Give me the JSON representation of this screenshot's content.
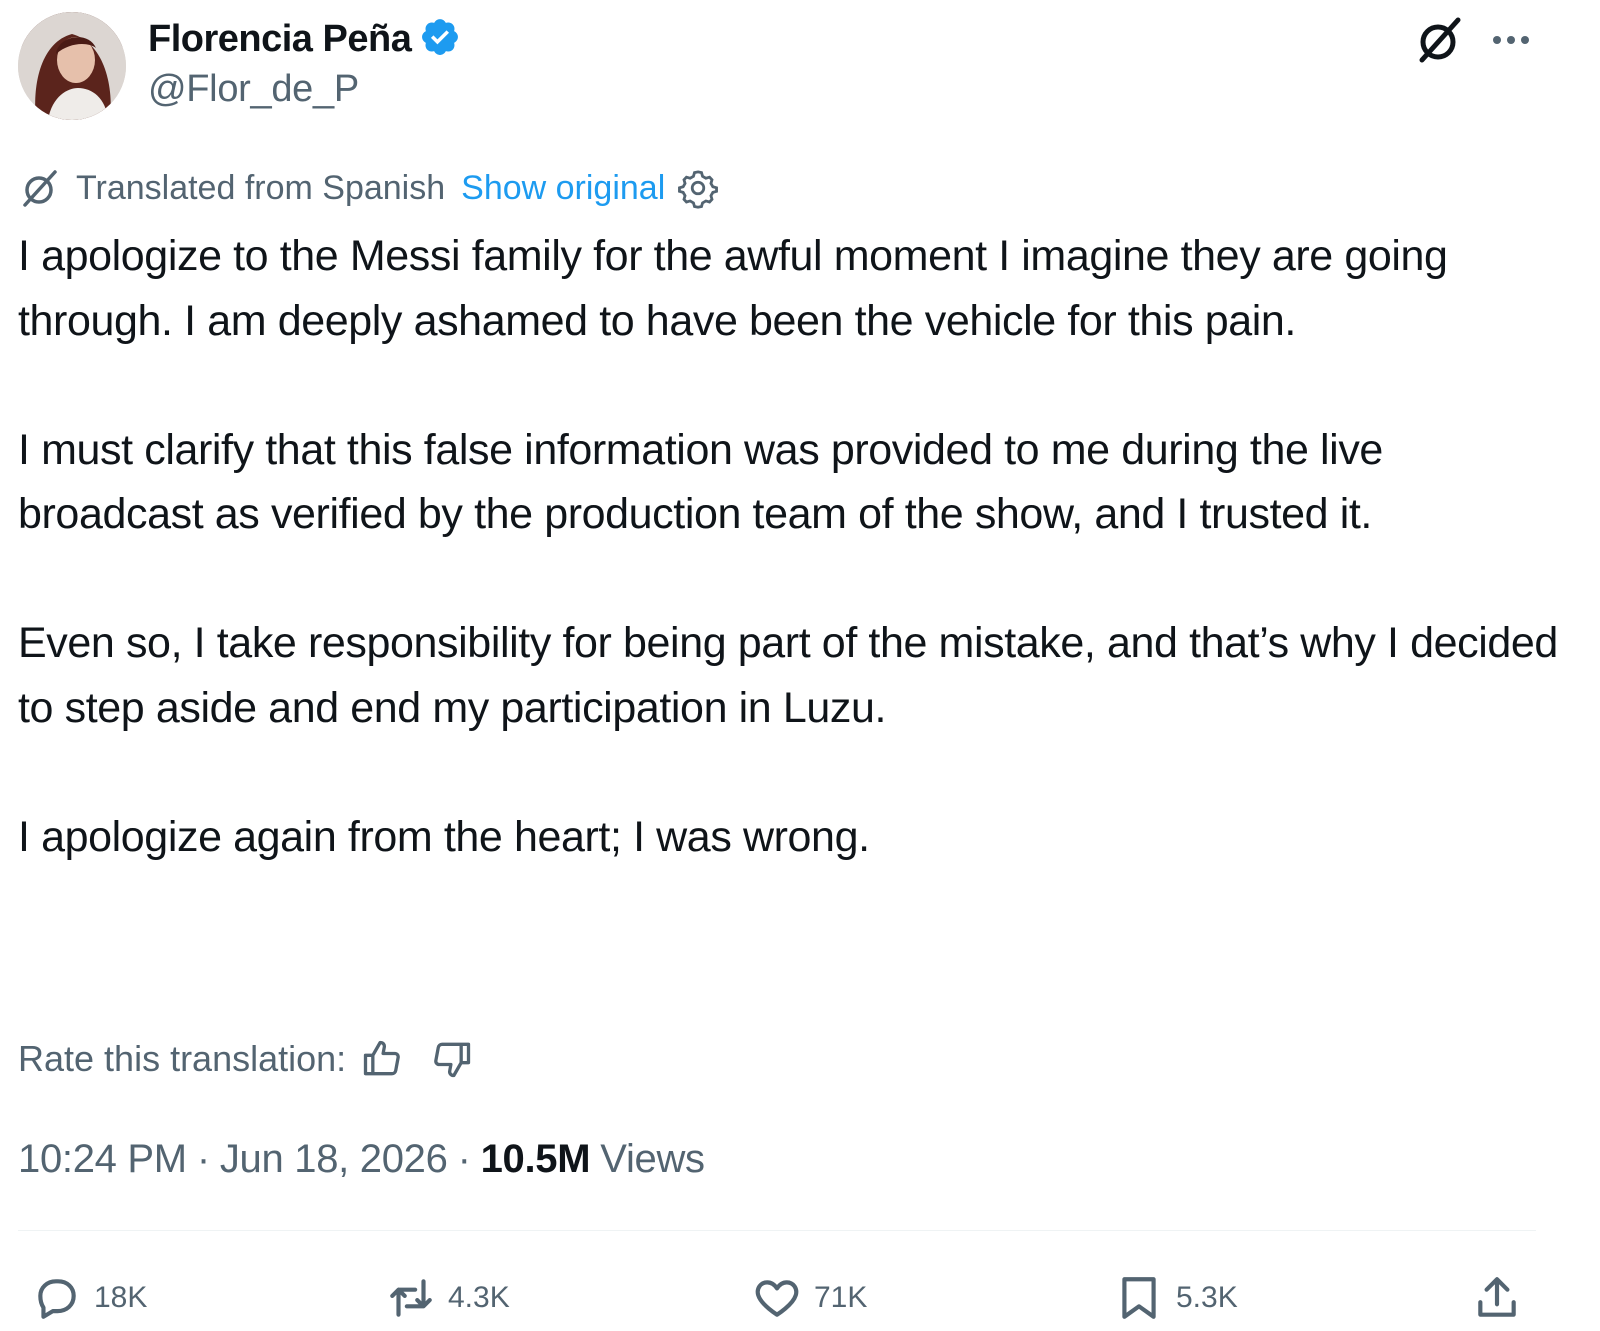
{
  "author": {
    "display_name": "Florencia Peña",
    "handle": "@Flor_de_P",
    "verified": true
  },
  "translation": {
    "label": "Translated from Spanish",
    "show_original": "Show original"
  },
  "tweet": {
    "paragraphs": [
      "I apologize to the Messi family for the awful moment I imagine they are going through. I am deeply ashamed to have been the vehicle for this pain.",
      "I must clarify that this false information was provided to me during the live broadcast as verified by the production team of the show, and I trusted it.",
      "Even so, I take responsibility for being part of the mistake, and that’s why I decided to step aside and end my participation in Luzu.",
      "I apologize again from the heart; I was wrong."
    ]
  },
  "rate": {
    "label": "Rate this translation:"
  },
  "meta": {
    "time": "10:24 PM",
    "separator": "·",
    "date": "Jun 18, 2026",
    "views_count": "10.5M",
    "views_label": "Views"
  },
  "actions": {
    "replies": "18K",
    "reposts": "4.3K",
    "likes": "71K",
    "bookmarks": "5.3K"
  },
  "colors": {
    "text_primary": "#0f1419",
    "text_secondary": "#536471",
    "accent": "#1d9bf0",
    "divider": "#eff3f4"
  },
  "icons": {
    "verified": "verified-badge-icon",
    "grok": "grok-icon",
    "more": "more-dots-icon",
    "translate": "translate-icon",
    "settings": "gear-icon",
    "thumbs_up": "thumbs-up-icon",
    "thumbs_down": "thumbs-down-icon",
    "reply": "reply-icon",
    "repost": "repost-icon",
    "like": "heart-icon",
    "bookmark": "bookmark-icon",
    "share": "share-icon"
  }
}
